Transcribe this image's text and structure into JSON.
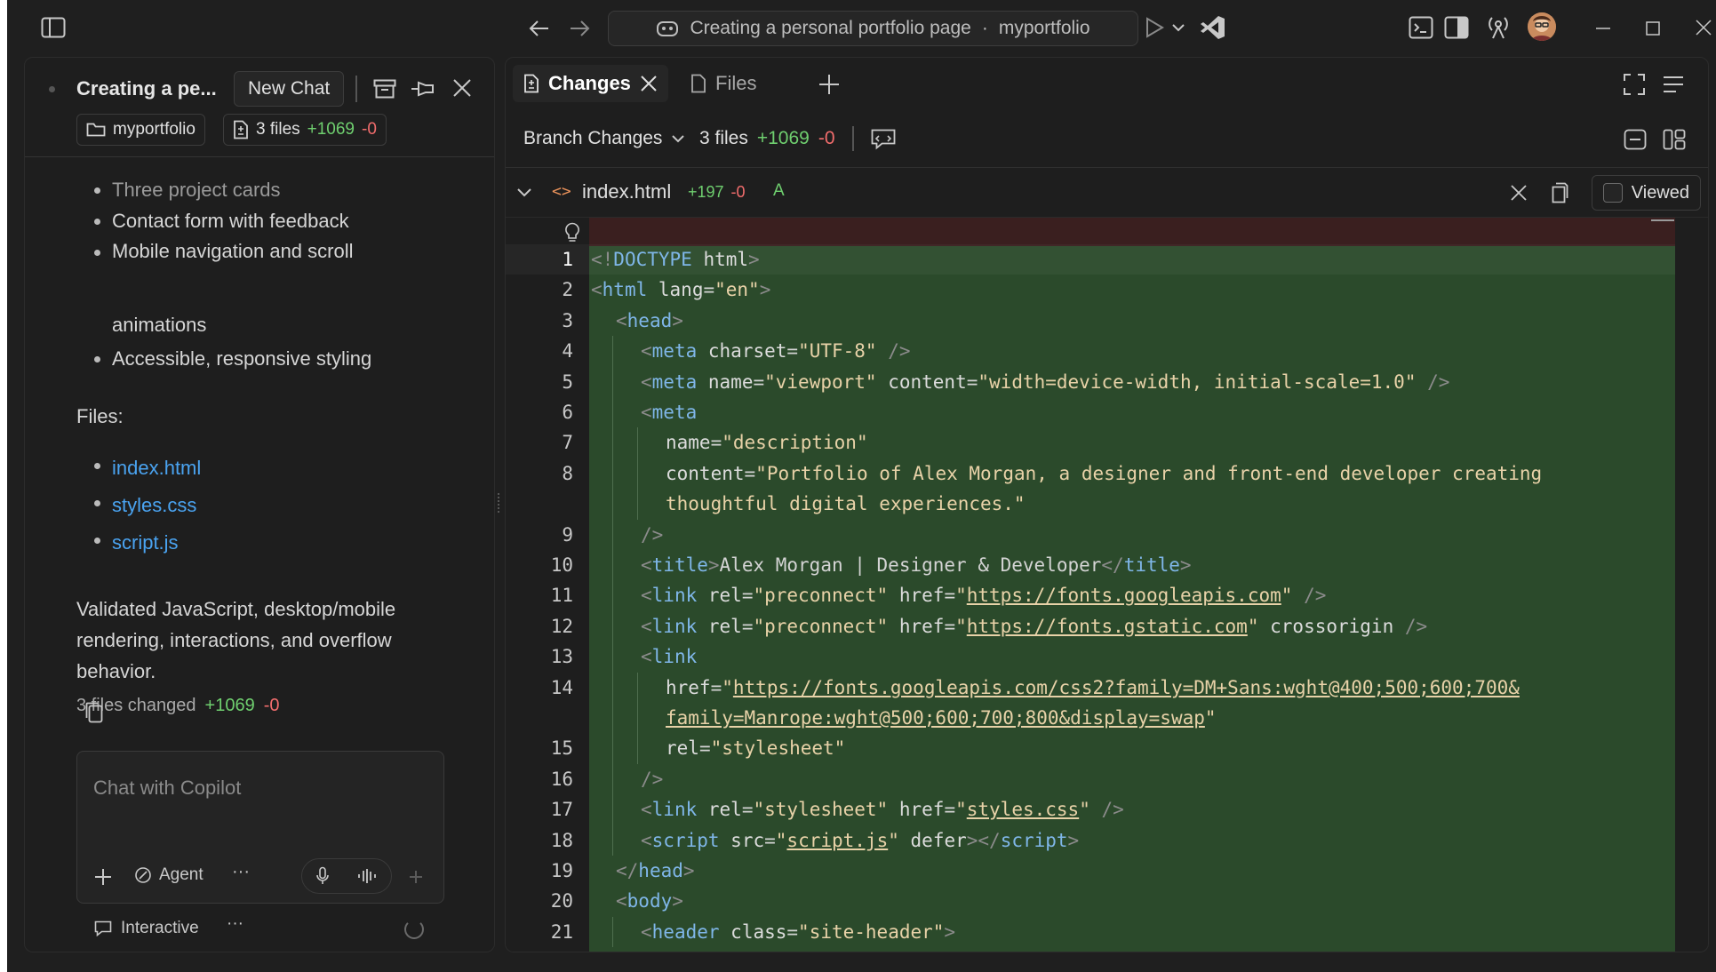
{
  "titlebar": {
    "command_center": "Creating a personal portfolio page",
    "workspace": "myportfolio",
    "separator": "·"
  },
  "chat": {
    "title": "Creating a pe...",
    "new_chat_label": "New Chat",
    "folder_chip": "myportfolio",
    "files_chip": {
      "label": "3 files",
      "added": "+1069",
      "removed": "-0"
    },
    "bullets_top": [
      "Three project cards",
      "Contact form with feedback",
      "Mobile navigation and scroll",
      "animations",
      "Accessible, responsive styling"
    ],
    "files_heading": "Files:",
    "files": [
      "index.html",
      "styles.css",
      "script.js"
    ],
    "summary_lines": [
      "Validated JavaScript, desktop/mobile",
      "rendering, interactions, and overflow",
      "behavior."
    ],
    "changed": {
      "label": "3 files changed",
      "added": "+1069",
      "removed": "-0"
    },
    "input_placeholder": "Chat with Copilot",
    "agent_label": "Agent",
    "more": "···",
    "mode_label": "Interactive",
    "mode_more": "···"
  },
  "editor": {
    "tabs": [
      {
        "label": "Changes",
        "active": true
      },
      {
        "label": "Files",
        "active": false
      }
    ],
    "branch_label": "Branch Changes",
    "branch_files": "3 files",
    "branch_added": "+1069",
    "branch_removed": "-0",
    "file": {
      "name": "index.html",
      "added": "+197",
      "removed": "-0",
      "status": "A"
    },
    "viewed_label": "Viewed",
    "colors": {
      "added_bg": "#2b4a2b",
      "removed_bg": "#3a1f1f",
      "plus": "#6fcf6f",
      "minus": "#f26d6d",
      "link": "#4aa3f0"
    }
  },
  "code_lines": [
    {
      "n": "1",
      "html": "<span class=\"punc\">&lt;!</span><span class=\"tag\">DOCTYPE</span> <span class=\"attr\">html</span><span class=\"punc\">&gt;</span>",
      "indent": 0
    },
    {
      "n": "2",
      "html": "<span class=\"punc\">&lt;</span><span class=\"tag\">html</span> <span class=\"attr\">lang</span>=<span class=\"str\">\"en\"</span><span class=\"punc\">&gt;</span>",
      "indent": 0
    },
    {
      "n": "3",
      "html": "<span class=\"punc\">&lt;</span><span class=\"tag\">head</span><span class=\"punc\">&gt;</span>",
      "indent": 1
    },
    {
      "n": "4",
      "html": "<span class=\"punc\">&lt;</span><span class=\"tag\">meta</span> <span class=\"attr\">charset</span>=<span class=\"str\">\"UTF-8\"</span> <span class=\"punc\">/&gt;</span>",
      "indent": 2
    },
    {
      "n": "5",
      "html": "<span class=\"punc\">&lt;</span><span class=\"tag\">meta</span> <span class=\"attr\">name</span>=<span class=\"str\">\"viewport\"</span> <span class=\"attr\">content</span>=<span class=\"str\">\"width=device-width, initial-scale=1.0\"</span> <span class=\"punc\">/&gt;</span>",
      "indent": 2
    },
    {
      "n": "6",
      "html": "<span class=\"punc\">&lt;</span><span class=\"tag\">meta</span>",
      "indent": 2
    },
    {
      "n": "7",
      "html": "<span class=\"attr\">name</span>=<span class=\"str\">\"description\"</span>",
      "indent": 3
    },
    {
      "n": "8",
      "html": "<span class=\"attr\">content</span>=<span class=\"str\">\"Portfolio of Alex Morgan, a designer and front-end developer creating</span>",
      "indent": 3
    },
    {
      "n": "",
      "html": "<span class=\"str\">thoughtful digital experiences.\"</span>",
      "indent": 3
    },
    {
      "n": "9",
      "html": "<span class=\"punc\">/&gt;</span>",
      "indent": 2
    },
    {
      "n": "10",
      "html": "<span class=\"punc\">&lt;</span><span class=\"tag\">title</span><span class=\"punc\">&gt;</span>Alex Morgan | Designer &amp; Developer<span class=\"punc\">&lt;/</span><span class=\"tag\">title</span><span class=\"punc\">&gt;</span>",
      "indent": 2
    },
    {
      "n": "11",
      "html": "<span class=\"punc\">&lt;</span><span class=\"tag\">link</span> <span class=\"attr\">rel</span>=<span class=\"str\">\"preconnect\"</span> <span class=\"attr\">href</span>=<span class=\"str\">\"</span><span class=\"url\">https://fonts.googleapis.com</span><span class=\"str\">\"</span> <span class=\"punc\">/&gt;</span>",
      "indent": 2
    },
    {
      "n": "12",
      "html": "<span class=\"punc\">&lt;</span><span class=\"tag\">link</span> <span class=\"attr\">rel</span>=<span class=\"str\">\"preconnect\"</span> <span class=\"attr\">href</span>=<span class=\"str\">\"</span><span class=\"url\">https://fonts.gstatic.com</span><span class=\"str\">\"</span> <span class=\"attr\">crossorigin</span> <span class=\"punc\">/&gt;</span>",
      "indent": 2
    },
    {
      "n": "13",
      "html": "<span class=\"punc\">&lt;</span><span class=\"tag\">link</span>",
      "indent": 2
    },
    {
      "n": "14",
      "html": "<span class=\"attr\">href</span>=<span class=\"str\">\"</span><span class=\"url\">https://fonts.googleapis.com/css2?family=DM+Sans:wght@400;500;600;700&amp;</span>",
      "indent": 3
    },
    {
      "n": "",
      "html": "<span class=\"url\">family=Manrope:wght@500;600;700;800&amp;display=swap</span><span class=\"str\">\"</span>",
      "indent": 3
    },
    {
      "n": "15",
      "html": "<span class=\"attr\">rel</span>=<span class=\"str\">\"stylesheet\"</span>",
      "indent": 3
    },
    {
      "n": "16",
      "html": "<span class=\"punc\">/&gt;</span>",
      "indent": 2
    },
    {
      "n": "17",
      "html": "<span class=\"punc\">&lt;</span><span class=\"tag\">link</span> <span class=\"attr\">rel</span>=<span class=\"str\">\"stylesheet\"</span> <span class=\"attr\">href</span>=<span class=\"str\">\"</span><span class=\"url\">styles.css</span><span class=\"str\">\"</span> <span class=\"punc\">/&gt;</span>",
      "indent": 2
    },
    {
      "n": "18",
      "html": "<span class=\"punc\">&lt;</span><span class=\"tag\">script</span> <span class=\"attr\">src</span>=<span class=\"str\">\"</span><span class=\"url\">script.js</span><span class=\"str\">\"</span> <span class=\"attr\">defer</span><span class=\"punc\">&gt;&lt;/</span><span class=\"tag\">script</span><span class=\"punc\">&gt;</span>",
      "indent": 2
    },
    {
      "n": "19",
      "html": "<span class=\"punc\">&lt;/</span><span class=\"tag\">head</span><span class=\"punc\">&gt;</span>",
      "indent": 1
    },
    {
      "n": "20",
      "html": "<span class=\"punc\">&lt;</span><span class=\"tag\">body</span><span class=\"punc\">&gt;</span>",
      "indent": 1
    },
    {
      "n": "21",
      "html": "<span class=\"punc\">&lt;</span><span class=\"tag\">header</span> <span class=\"attr\">class</span>=<span class=\"str\">\"site-header\"</span><span class=\"punc\">&gt;</span>",
      "indent": 2
    }
  ]
}
